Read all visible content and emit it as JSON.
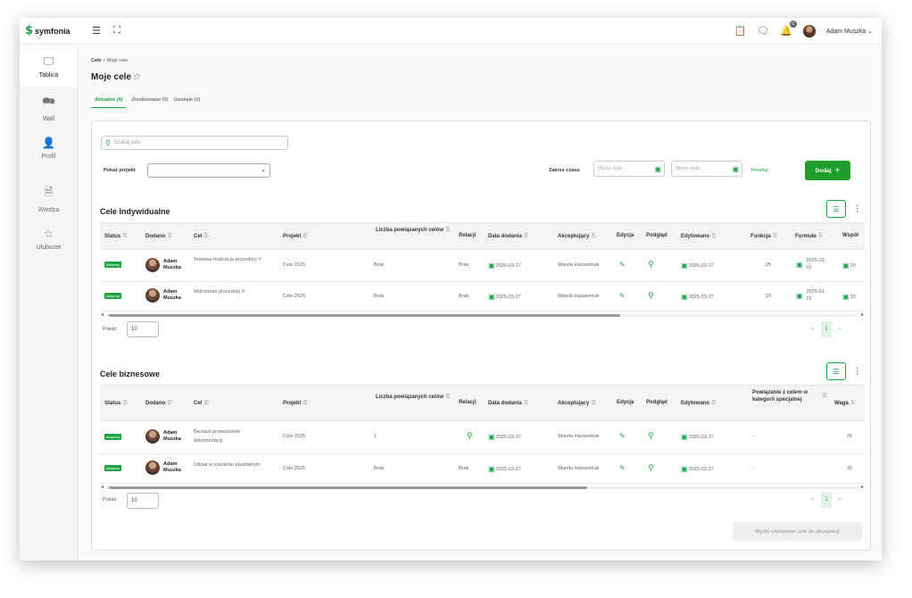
{
  "topbar": {
    "logo_text": "symfonia",
    "logo_sub": "HR",
    "user_name": "Adam Muszka",
    "notif_count": "0"
  },
  "sidebar": {
    "items": [
      {
        "label": "Tablica",
        "icon": "monitor-icon"
      },
      {
        "label": "Wall",
        "icon": "chat-icon"
      },
      {
        "label": "Profil",
        "icon": "person-icon"
      },
      {
        "label": "Wiedza",
        "icon": "document-icon"
      },
      {
        "label": "Ulubione",
        "icon": "star-icon"
      }
    ]
  },
  "breadcrumb": {
    "root": "Cele",
    "sep": ">",
    "current": "Moje cele"
  },
  "page_title": "Moje cele",
  "tabs": [
    {
      "label": "Aktualne (4)"
    },
    {
      "label": "Zrealizowane (0)"
    },
    {
      "label": "Usunięte (0)"
    }
  ],
  "filters": {
    "search_placeholder": "Szukaj celu",
    "project_label": "Pokaż projekt",
    "project_value": "",
    "time_range_label": "Zakres czasu",
    "date_from_placeholder": "Wpisz datę...",
    "date_to_placeholder": "Wpisz datę...",
    "reset_label": "Resetuj",
    "add_label": "Dodaj"
  },
  "individual": {
    "title": "Cele Indywidualne",
    "headers": [
      "Status",
      "Dodano",
      "Cel",
      "Projekt",
      "Liczba powiązanych celów",
      "Relacji",
      "Data dodania",
      "Akceptujący",
      "Edycja",
      "Podgląd",
      "Edytowano",
      "Funkcja",
      "Formuła",
      "Współ"
    ],
    "rows": [
      {
        "status": "Aktywny",
        "added_by": "Adam Muszka",
        "goal": "Testowa realizacja procedury Y",
        "project": "Cele 2025",
        "linked": "Brak",
        "relations": "Brak",
        "date_added": "2025-03-27",
        "acceptor": "Wanda Harasimiuk",
        "edited": "2025-03-27",
        "function": "25",
        "formula": "2025-01-01",
        "extra": "20"
      },
      {
        "status": "Aktywny",
        "added_by": "Adam Muszka",
        "goal": "Wdrożenie procedury X",
        "project": "Cele 2025",
        "linked": "Brak",
        "relations": "Brak",
        "date_added": "2025-03-27",
        "acceptor": "Wanda Harasimiuk",
        "edited": "2025-03-27",
        "function": "20",
        "formula": "2025-01-01",
        "extra": "20"
      }
    ],
    "pokaz_label": "Pokaż:",
    "page_size": "10",
    "page": "1"
  },
  "business": {
    "title": "Cele biznesowe",
    "headers": [
      "Status",
      "Dodano",
      "Cel",
      "Projekt",
      "Liczba powiązanych celów",
      "Relacji",
      "Data dodania",
      "Akceptujący",
      "Edycja",
      "Podgląd",
      "Edytowano",
      "Powiązanie z celem w kategorii specjalnej",
      "Waga"
    ],
    "rows": [
      {
        "status": "Aktywny",
        "added_by": "Adam Muszka",
        "goal": "Bieżące prowadzenie dokumentacji",
        "project": "Cele 2025",
        "linked": "1",
        "date_added": "2025-03-27",
        "acceptor": "Wanda Harasimiuk",
        "edited": "2025-03-27",
        "special": "-",
        "weight": "25"
      },
      {
        "status": "Aktywny",
        "added_by": "Adam Muszka",
        "goal": "Udział w szkoleniu kwartalnym",
        "project": "Cele 2025",
        "linked": "Brak",
        "relations": "Brak",
        "date_added": "2025-03-27",
        "acceptor": "Wanda Harasimiuk",
        "edited": "2025-03-27",
        "special": "-",
        "weight": "30"
      }
    ],
    "pokaz_label": "Pokaż:",
    "page_size": "10",
    "page": "1"
  },
  "send_label": "Wyślij edytowane cele do akceptacji",
  "colors": {
    "accent": "#1fa243"
  }
}
